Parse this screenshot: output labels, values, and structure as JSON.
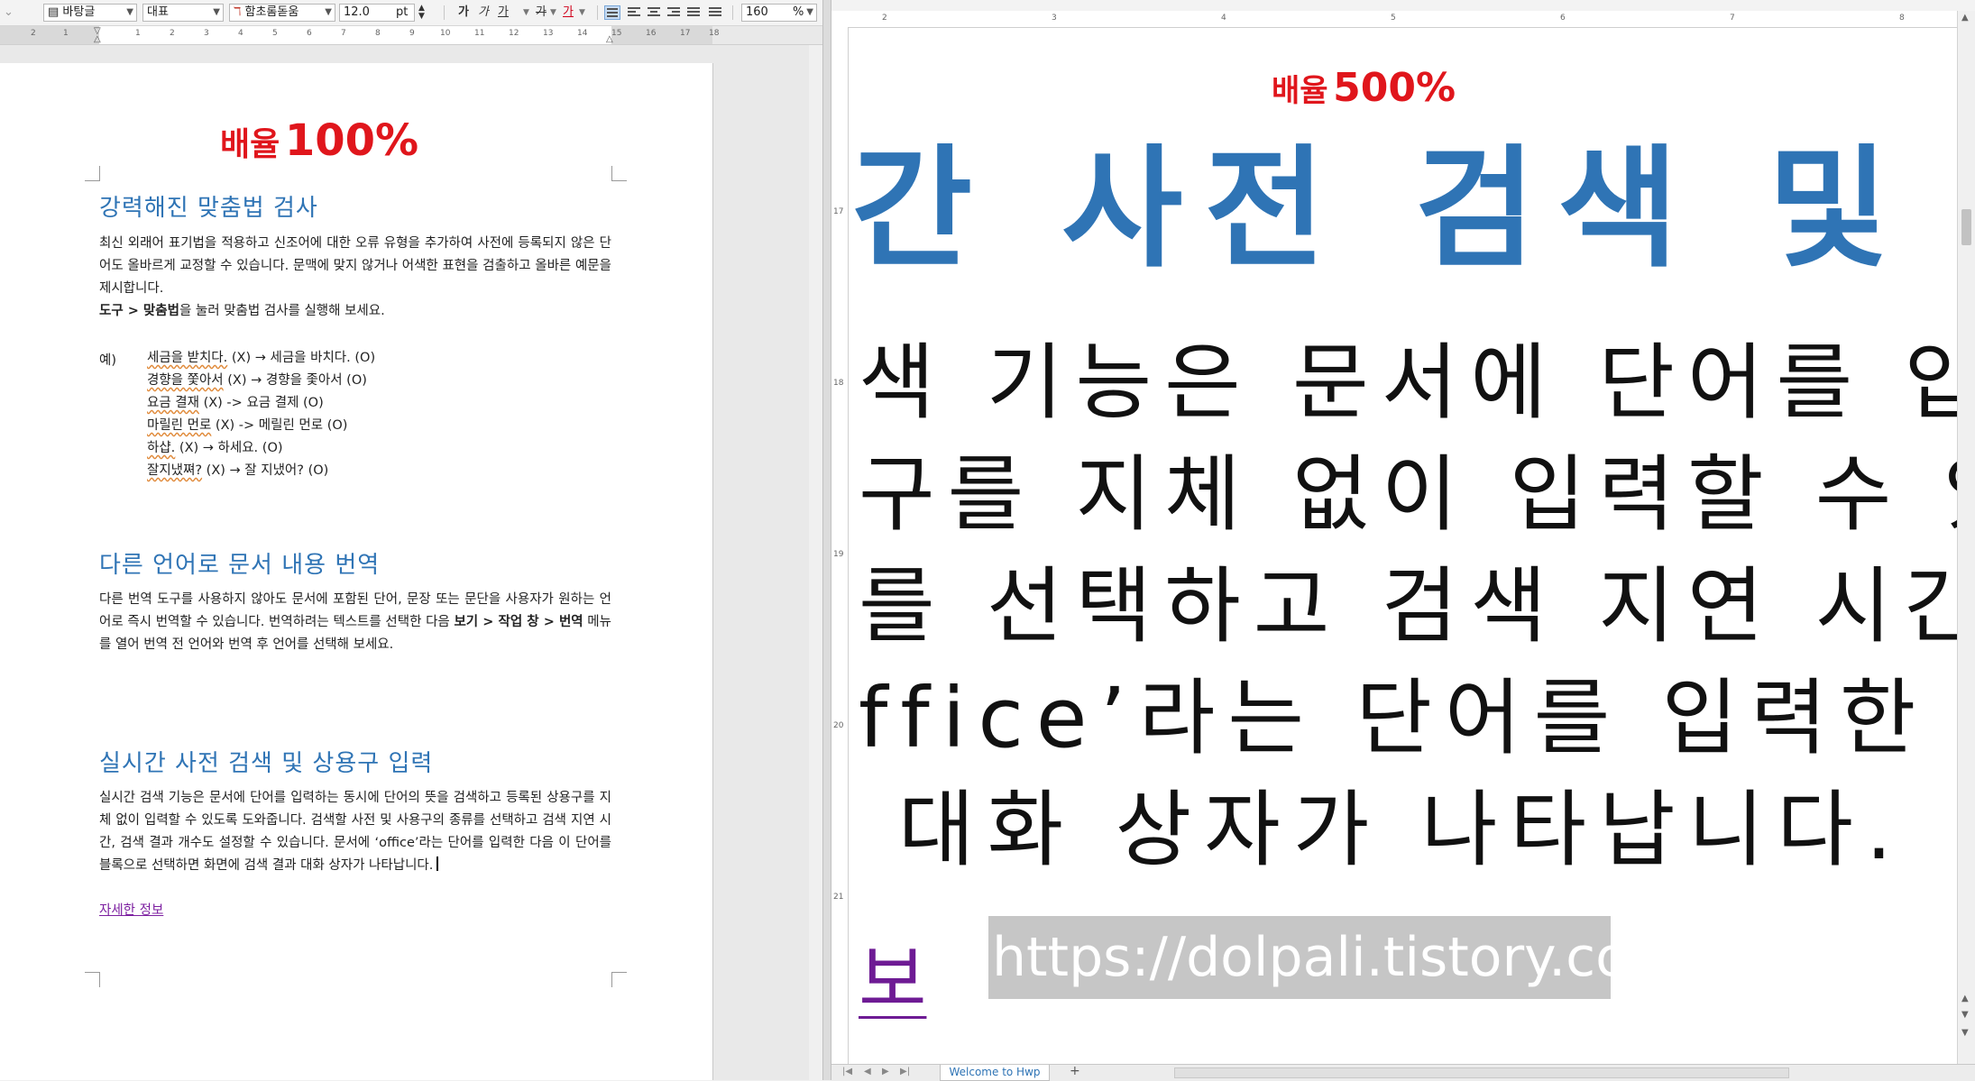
{
  "toolbar": {
    "font_group": "바탕글",
    "style": "대표",
    "font_name": "함초롬돋움",
    "font_size": "12.0",
    "font_unit": "pt",
    "zoom": "160",
    "zoom_unit": "%",
    "bold_label": "가",
    "italic_label": "가",
    "underline_label": "가",
    "strike_label": "가",
    "color_label": "가"
  },
  "left_doc": {
    "zoom_prefix": "배율",
    "zoom_value": "100%",
    "section1": {
      "title": "강력해진 맞춤법 검사",
      "body": "최신 외래어 표기법을 적용하고 신조어에 대한 오류 유형을 추가하여 사전에 등록되지 않은 단어도 올바르게 교정할 수 있습니다. 문맥에 맞지 않거나 어색한 표현을 검출하고 올바른 예문을 제시합니다.",
      "instr_bold1": "도구 > 맞춤법",
      "instr_rest": "을 눌러 맞춤법 검사를 실행해 보세요.",
      "example_label": "예)",
      "examples": [
        {
          "wrong": "세금을 받치다.",
          "mid": " (X) → ",
          "right": "세금을 바치다.",
          "tail": " (O)"
        },
        {
          "wrong": "경향을 쫓아서",
          "mid": " (X) → ",
          "right": "경향을 좇아서",
          "tail": " (O)"
        },
        {
          "wrong": "요금 결재",
          "mid": " (X) -> ",
          "right": "요금 결제",
          "tail": " (O)"
        },
        {
          "wrong": "마릴린 먼로",
          "mid": " (X) -> ",
          "right": "메릴린 먼로",
          "tail": " (O)"
        },
        {
          "wrong": "하샵.",
          "mid": " (X) → ",
          "right": "하세요.",
          "tail": " (O)"
        },
        {
          "wrong": "잘지냈쪄?",
          "mid": " (X) → ",
          "right": "잘 지냈어?",
          "tail": " (O)"
        }
      ]
    },
    "section2": {
      "title": "다른 언어로 문서 내용 번역",
      "body_a": "다른 번역 도구를 사용하지 않아도 문서에 포함된 단어, 문장 또는 문단을 사용자가 원하는 언어로 즉시 번역할 수 있습니다. 번역하려는 텍스트를 선택한 다음 ",
      "body_bold": "보기 > 작업 창 > 번역",
      "body_b": " 메뉴를 열어 번역 전 언어와 번역 후 언어를 선택해 보세요."
    },
    "section3": {
      "title": "실시간 사전 검색 및 상용구 입력",
      "body": "실시간 검색 기능은 문서에 단어를 입력하는 동시에 단어의 뜻을 검색하고 등록된 상용구를 지체 없이 입력할 수 있도록 도와줍니다. 검색할 사전 및 사용구의 종류를 선택하고 검색 지연 시간, 검색 결과 개수도 설정할 수 있습니다. 문서에 ‘office’라는 단어를 입력한 다음 이 단어를 블록으로 선택하면 화면에 검색 결과 대화 상자가 나타납니다.",
      "link": "자세한 정보"
    }
  },
  "right_doc": {
    "zoom_prefix": "배율",
    "zoom_value": "500%",
    "heading": "간 사전 검색 및 상용구",
    "lines": [
      "색 기능은 문서에 단어를 입력하는",
      "구를 지체 없이 입력할 수 있도록",
      "를 선택하고 검색 지연 시간, 검색",
      "ffice’라는 단어를 입력한 다음 이",
      "대화 상자가 나타납니다."
    ],
    "link": "보",
    "watermark": "https://dolpali.tistory.com"
  },
  "tabs": {
    "doc_tab": "Welcome to Hwp",
    "add_tab": "+"
  }
}
